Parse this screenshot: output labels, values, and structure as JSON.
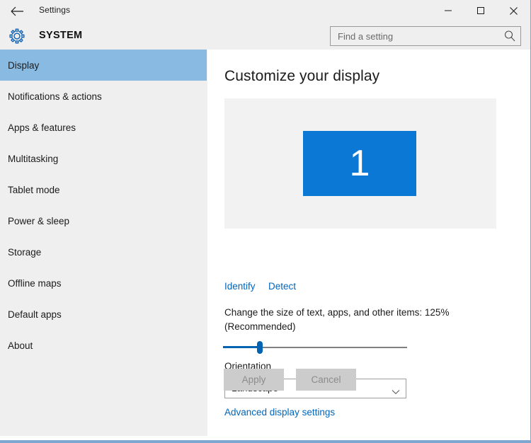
{
  "window": {
    "app_title": "Settings",
    "back_icon": "back-arrow-icon",
    "minimize_label": "—",
    "maximize_label": "□",
    "close_label": "✕"
  },
  "header": {
    "category_title": "SYSTEM",
    "gear_icon": "gear-icon"
  },
  "search": {
    "placeholder": "Find a setting",
    "value": "",
    "icon": "search-icon"
  },
  "sidebar": {
    "items": [
      {
        "label": "Display",
        "selected": true
      },
      {
        "label": "Notifications & actions",
        "selected": false
      },
      {
        "label": "Apps & features",
        "selected": false
      },
      {
        "label": "Multitasking",
        "selected": false
      },
      {
        "label": "Tablet mode",
        "selected": false
      },
      {
        "label": "Power & sleep",
        "selected": false
      },
      {
        "label": "Storage",
        "selected": false
      },
      {
        "label": "Offline maps",
        "selected": false
      },
      {
        "label": "Default apps",
        "selected": false
      },
      {
        "label": "About",
        "selected": false
      }
    ]
  },
  "main": {
    "page_title": "Customize your display",
    "monitor": {
      "number": "1",
      "color": "#0a78d4"
    },
    "links": {
      "identify": "Identify",
      "detect": "Detect",
      "advanced": "Advanced display settings"
    },
    "scale": {
      "label": "Change the size of text, apps, and other items: 125% (Recommended)",
      "percent": "125%",
      "slider_position_percent": 20
    },
    "orientation": {
      "label": "Orientation",
      "selected": "Landscape",
      "chevron_icon": "chevron-down-icon"
    },
    "buttons": {
      "apply": "Apply",
      "cancel": "Cancel",
      "apply_enabled": false,
      "cancel_enabled": false
    }
  },
  "colors": {
    "accent_blue": "#0063b1",
    "link_blue": "#0066bb",
    "selection_blue": "#89bbe2",
    "chrome_gray": "#efefef",
    "panel_gray": "#f2f2f2"
  }
}
